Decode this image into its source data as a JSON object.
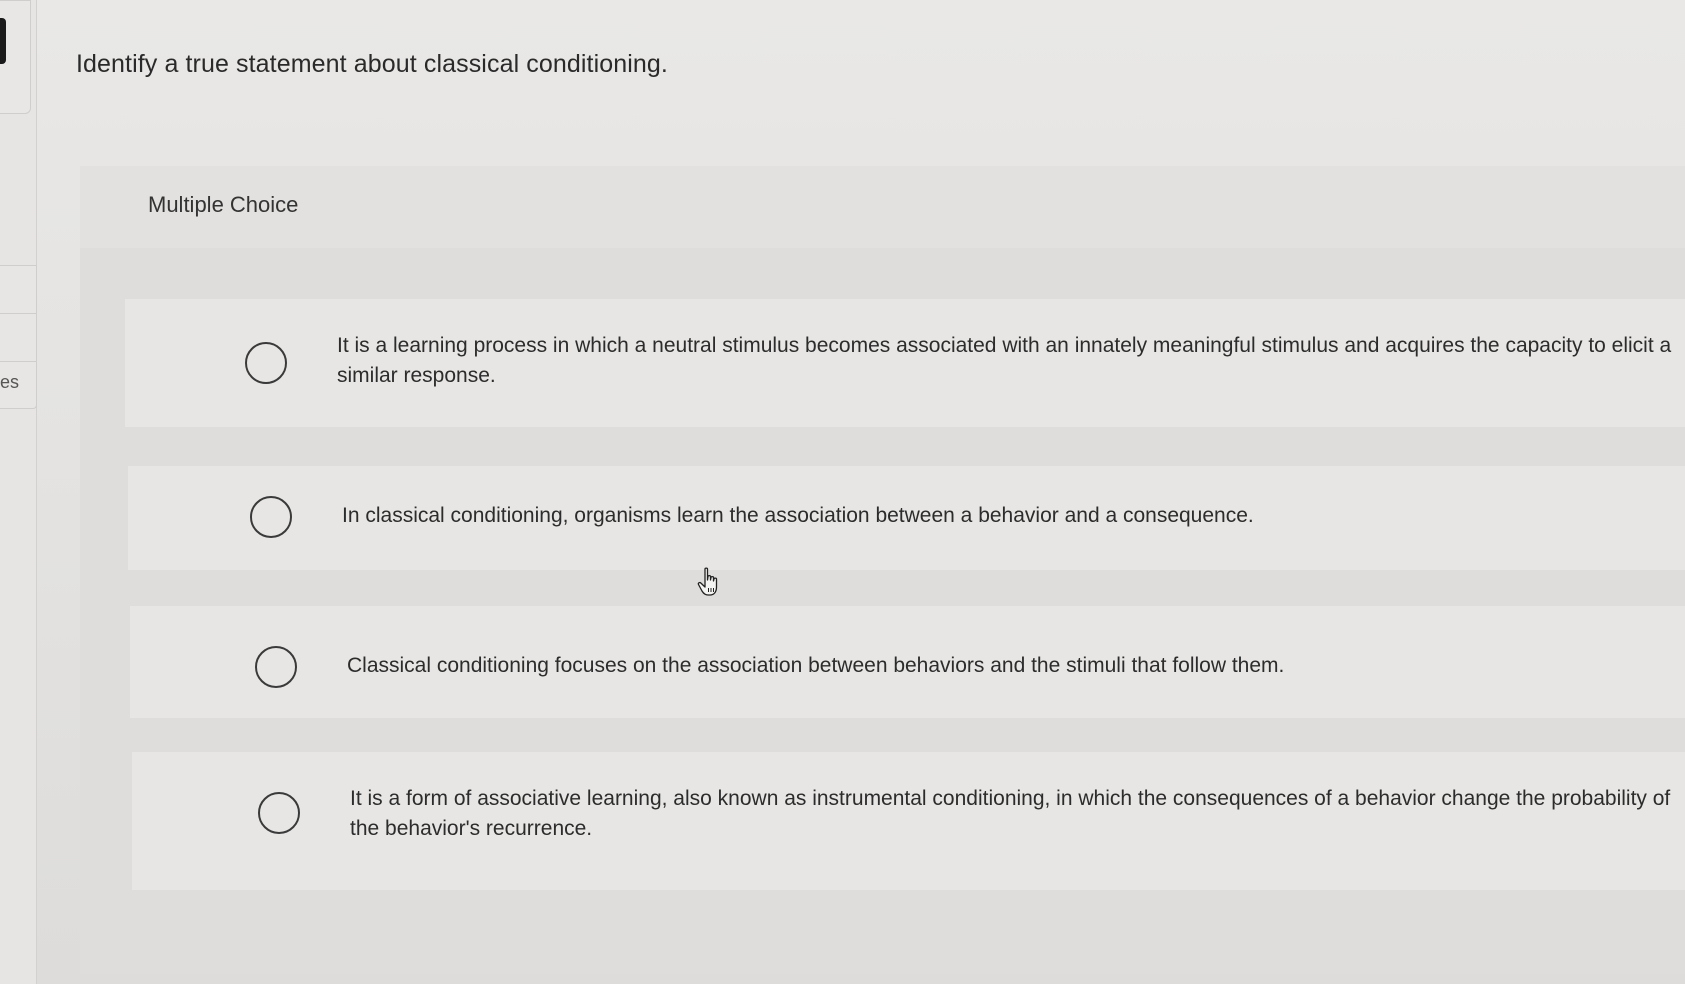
{
  "sidebar": {
    "tab_label": "es"
  },
  "question": {
    "text": "Identify a true statement about classical conditioning."
  },
  "multiple_choice": {
    "heading": "Multiple Choice",
    "options": [
      {
        "text": "It is a learning process in which a neutral stimulus becomes associated with an innately meaningful stimulus and acquires the capacity to elicit a similar response.",
        "selected": false
      },
      {
        "text": "In classical conditioning, organisms learn the association between a behavior and a consequence.",
        "selected": false
      },
      {
        "text": "Classical conditioning focuses on the association between behaviors and the stimuli that follow them.",
        "selected": false
      },
      {
        "text": "It is a form of associative learning, also known as instrumental conditioning, in which the consequences of a behavior change the probability of the behavior's recurrence.",
        "selected": false
      }
    ]
  },
  "icons": {
    "radio": "radio-unselected-icon",
    "cursor": "hand-pointer-icon"
  },
  "colors": {
    "background": "#e4e3e1",
    "option_background": "#e7e6e4",
    "text": "#2c2c2c",
    "radio_border": "#3a3a3a"
  }
}
